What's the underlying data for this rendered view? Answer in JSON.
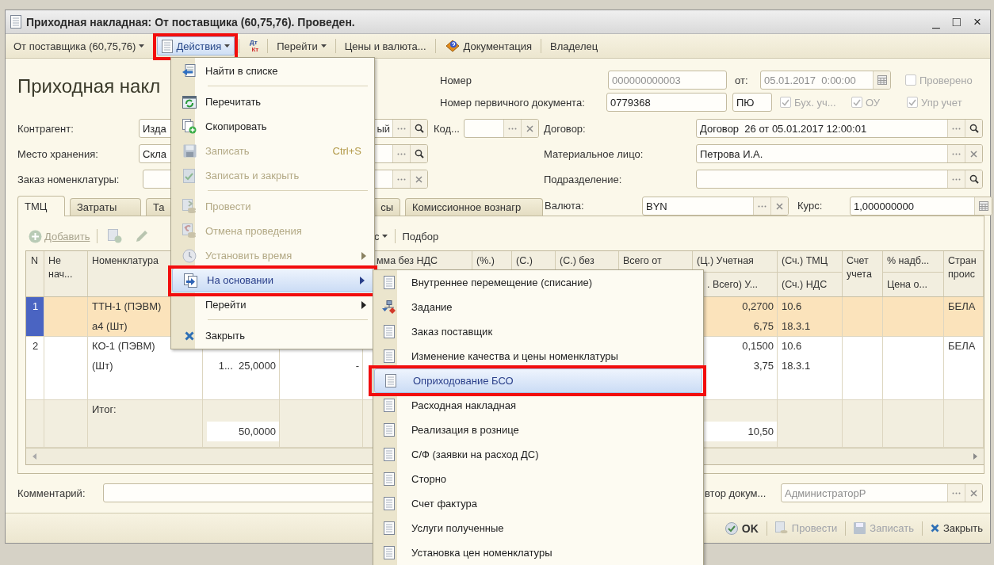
{
  "window": {
    "title": "Приходная накладная: От поставщика (60,75,76). Проведен.",
    "controls": [
      "_",
      "□",
      "×"
    ]
  },
  "toolbar": [
    {
      "kind": "dropdown",
      "label": "От поставщика (60,75,76)",
      "pressed": false,
      "annotated": false
    },
    {
      "kind": "menu",
      "label": "Действия",
      "pressed": true,
      "annotated": true
    },
    {
      "kind": "dtkt",
      "top": "Дт",
      "bottom": "Кт",
      "pressed": false,
      "annotated": false
    },
    {
      "kind": "dropdown",
      "label": "Перейти",
      "pressed": false,
      "annotated": false
    },
    {
      "kind": "plain",
      "label": "Цены и валюта...",
      "pressed": false,
      "annotated": false
    },
    {
      "kind": "help",
      "label": "Документация",
      "pressed": false,
      "annotated": false
    },
    {
      "kind": "plain",
      "label": "Владелец",
      "pressed": false,
      "annotated": false
    }
  ],
  "form": {
    "heading": "Приходная накл",
    "number": {
      "label": "Номер",
      "value": "000000000003",
      "readonly": true
    },
    "date": {
      "label": "от:",
      "value": "05.01.2017  0:00:00",
      "readonly": true,
      "buttons": [
        {
          "kind": "calendar"
        }
      ]
    },
    "verified": {
      "label": "Проверено",
      "checked": false,
      "disabled": true
    },
    "primary_doc": {
      "label": "Номер первичного документа:",
      "value": "0779368",
      "readonly": false
    },
    "series": {
      "value": "ПЮ",
      "readonly": false
    },
    "flags": [
      {
        "label": "Бух. уч...",
        "checked": true,
        "disabled": true
      },
      {
        "label": "ОУ",
        "checked": true,
        "disabled": true
      },
      {
        "label": "Упр учет",
        "checked": true,
        "disabled": true
      }
    ],
    "counterparty": {
      "label": "Контрагент:",
      "value": "Изда",
      "value_end": "ый",
      "buttons": [
        {
          "kind": "select"
        },
        {
          "kind": "search"
        }
      ]
    },
    "code": {
      "label": "Код...",
      "buttons": [
        {
          "kind": "select"
        },
        {
          "kind": "clear"
        }
      ]
    },
    "contract": {
      "label": "Договор:",
      "value": "Договор  26 от 05.01.2017 12:00:01",
      "buttons": [
        {
          "kind": "select"
        },
        {
          "kind": "search"
        }
      ]
    },
    "storage": {
      "label": "Место хранения:",
      "value": "Скла",
      "buttons": [
        {
          "kind": "select"
        },
        {
          "kind": "search"
        }
      ]
    },
    "responsible": {
      "label": "Материальное лицо:",
      "value": "Петрова И.А.",
      "buttons": [
        {
          "kind": "select"
        },
        {
          "kind": "clear"
        }
      ]
    },
    "order": {
      "label": "Заказ номенклатуры:",
      "buttons": [
        {
          "kind": "select"
        },
        {
          "kind": "clear"
        }
      ]
    },
    "department": {
      "label": "Подразделение:",
      "buttons": [
        {
          "kind": "select"
        },
        {
          "kind": "search"
        }
      ]
    },
    "currency": {
      "label": "Валюта:",
      "value": "BYN",
      "buttons": [
        {
          "kind": "select"
        },
        {
          "kind": "clear"
        }
      ]
    },
    "rate": {
      "label": "Курс:",
      "value": "1,000000000",
      "buttons": [
        {
          "kind": "calculator"
        }
      ]
    },
    "comment": {
      "label": "Комментарий:"
    },
    "author": {
      "label": "втор докум...",
      "value": "АдминистраторР",
      "readonly": true,
      "buttons": [
        {
          "kind": "select"
        },
        {
          "kind": "clear"
        }
      ]
    }
  },
  "tabs": [
    {
      "label": "ТМЦ",
      "selected": true
    },
    {
      "label": "Затраты",
      "selected": false
    },
    {
      "label": "Та",
      "selected": false
    },
    {
      "label": "сы",
      "selected": false
    },
    {
      "label": "Комиссионное вознагр",
      "selected": false
    }
  ],
  "table_toolbar": [
    {
      "kind": "add",
      "label": "Добавить",
      "disabled": true
    },
    {
      "kind": "copy",
      "disabled": true
    },
    {
      "kind": "edit",
      "disabled": true
    },
    {
      "kind": "dropdown",
      "label": "с",
      "disabled": false
    },
    {
      "kind": "plain",
      "label": "Подбор",
      "disabled": false
    }
  ],
  "table": {
    "rows": [
      {
        "selected": true
      },
      {
        "selected": false
      }
    ],
    "columns": [
      {
        "label": "N",
        "row1": {
          "upper": "1"
        },
        "row2": {
          "upper": "2"
        }
      },
      {
        "label": "Не нач..."
      },
      {
        "label": "Номенклатура",
        "row1": {
          "upper": "ТТН-1 (ПЭВМ)",
          "lower": "а4 (Шт)"
        },
        "row2": {
          "upper": "КО-1 (ПЭВМ)",
          "lower": "(Шт)"
        },
        "total": {
          "upper": "Итог:"
        }
      },
      {
        "row2": {
          "lower": "1...  25,0000"
        },
        "total": {
          "lower": "50,0000"
        }
      },
      {
        "row2": {
          "lower": "-"
        }
      },
      {
        "label": "мма без НДС"
      },
      {
        "label": "(%.)"
      },
      {
        "label": "(С.)"
      },
      {
        "label": "(С.) без"
      },
      {
        "label": "Всего от"
      },
      {
        "label": "(Ц.) Учетная",
        "sub": ". Всего) У...",
        "row1": {
          "upper": "0,2700",
          "lower": "6,75"
        },
        "row2": {
          "upper": "0,1500",
          "lower": "3,75"
        },
        "total": {
          "lower": "10,50"
        }
      },
      {
        "label": "(Сч.) ТМЦ",
        "sub": "(Сч.) НДС",
        "row1": {
          "upper": "10.6",
          "lower": "18.3.1"
        },
        "row2": {
          "upper": "10.6",
          "lower": "18.3.1"
        }
      },
      {
        "label": "Счет учета"
      },
      {
        "label": "% надб...",
        "sub": "Цена о..."
      },
      {
        "label": "Стран проис",
        "row1": {
          "upper": "БЕЛА"
        },
        "row2": {
          "upper": "БЕЛА"
        }
      }
    ]
  },
  "buttons": [
    {
      "kind": "ok",
      "label": "OK",
      "disabled": false
    },
    {
      "kind": "post",
      "label": "Провести",
      "disabled": true
    },
    {
      "kind": "save",
      "label": "Записать",
      "disabled": true
    },
    {
      "kind": "close",
      "label": "Закрыть",
      "disabled": false
    }
  ],
  "actions_menu": {
    "items": [
      {
        "kind": "item",
        "label": "Найти в списке",
        "disabled": false,
        "submenu": false,
        "selected": false,
        "annotated": false
      },
      {
        "kind": "separator"
      },
      {
        "kind": "item",
        "label": "Перечитать",
        "disabled": false,
        "submenu": false,
        "selected": false,
        "annotated": false
      },
      {
        "kind": "item",
        "label": "Скопировать",
        "disabled": false,
        "submenu": false,
        "selected": false,
        "annotated": false
      },
      {
        "kind": "item",
        "label": "Записать",
        "shortcut": "Ctrl+S",
        "disabled": true,
        "submenu": false,
        "selected": false,
        "annotated": false
      },
      {
        "kind": "item",
        "label": "Записать и закрыть",
        "disabled": true,
        "submenu": false,
        "selected": false,
        "annotated": false
      },
      {
        "kind": "separator"
      },
      {
        "kind": "item",
        "label": "Провести",
        "disabled": true,
        "submenu": false,
        "selected": false,
        "annotated": false
      },
      {
        "kind": "item",
        "label": "Отмена проведения",
        "disabled": true,
        "submenu": false,
        "selected": false,
        "annotated": false
      },
      {
        "kind": "item",
        "label": "Установить время",
        "disabled": true,
        "submenu": true,
        "selected": false,
        "annotated": false
      },
      {
        "kind": "item",
        "label": "На основании",
        "disabled": false,
        "submenu": true,
        "selected": true,
        "annotated": true
      },
      {
        "kind": "item",
        "label": "Перейти",
        "disabled": false,
        "submenu": true,
        "selected": false,
        "annotated": false
      },
      {
        "kind": "separator"
      },
      {
        "kind": "item",
        "label": "Закрыть",
        "disabled": false,
        "submenu": false,
        "selected": false,
        "annotated": false
      }
    ]
  },
  "based_on_menu": {
    "items": [
      {
        "label": "Внутреннее перемещение (списание)",
        "selected": false,
        "annotated": false
      },
      {
        "label": "Задание",
        "selected": false,
        "annotated": false
      },
      {
        "label": "Заказ поставщик",
        "selected": false,
        "annotated": false
      },
      {
        "label": "Изменение качества и цены номенклатуры",
        "selected": false,
        "annotated": false
      },
      {
        "label": "Оприходование БСО",
        "selected": true,
        "annotated": true
      },
      {
        "label": "Расходная накладная",
        "selected": false,
        "annotated": false
      },
      {
        "label": "Реализация в рознице",
        "selected": false,
        "annotated": false
      },
      {
        "label": "С/Ф (заявки на расход ДС)",
        "selected": false,
        "annotated": false
      },
      {
        "label": "Сторно",
        "selected": false,
        "annotated": false
      },
      {
        "label": "Счет фактура",
        "selected": false,
        "annotated": false
      },
      {
        "label": "Услуги полученные",
        "selected": false,
        "annotated": false
      },
      {
        "label": "Установка цен номенклатуры",
        "selected": false,
        "annotated": false
      }
    ]
  }
}
